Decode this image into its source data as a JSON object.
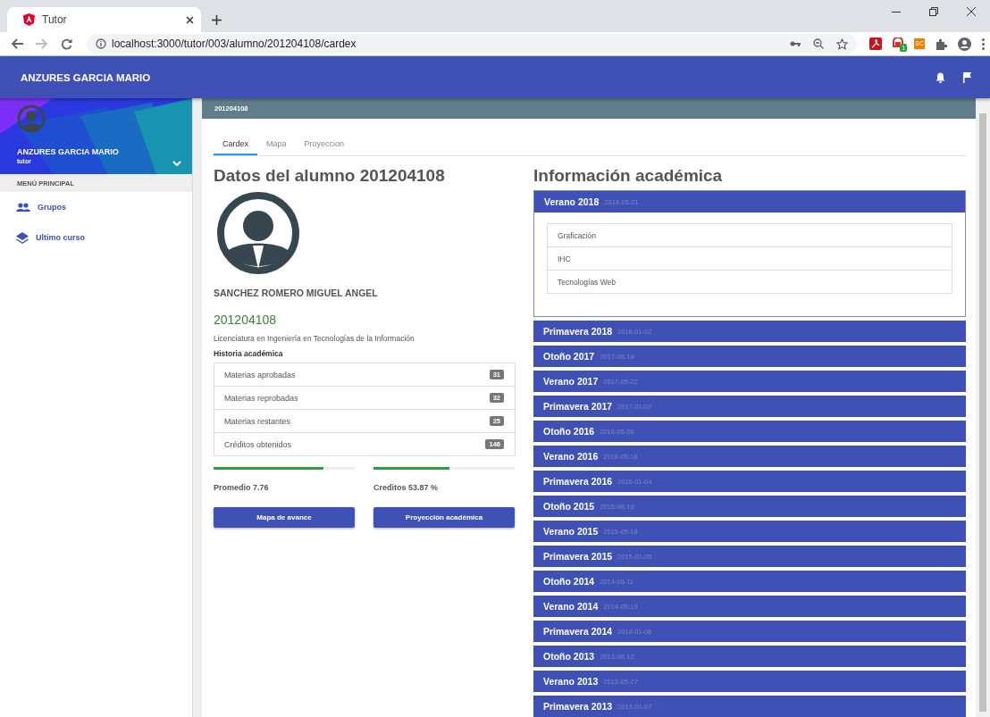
{
  "browser": {
    "tab_title": "Tutor",
    "url": "localhost:3000/tutor/003/alumno/201204108/cardex",
    "forward_disabled": true,
    "extensions": [
      {
        "kind": "pdf"
      },
      {
        "kind": "badge",
        "badge": "1"
      },
      {
        "kind": "text",
        "label": "SC"
      },
      {
        "kind": "puzzle"
      }
    ]
  },
  "toolbar": {
    "title": "ANZURES GARCIA MARIO"
  },
  "sidebar": {
    "user_name": "ANZURES GARCIA MARIO",
    "user_role": "tutor",
    "section": "MENÚ PRINCIPAL",
    "items": [
      {
        "label": "Grupos",
        "kind": "group",
        "selected": false
      },
      {
        "label": "Ultimo curso",
        "kind": "layers",
        "selected": false
      }
    ]
  },
  "breadcrumb": "201204108",
  "tabs": [
    {
      "label": "Cardex",
      "selected": true
    },
    {
      "label": "Mapa",
      "selected": false
    },
    {
      "label": "Proyeccion",
      "selected": false
    }
  ],
  "student": {
    "heading": "Datos del alumno 201204108",
    "name": "SANCHEZ ROMERO MIGUEL ANGEL",
    "id": "201204108",
    "program": "Licenciatura en Ingeniería en Tecnologías de la Información",
    "history_title": "Historia académica",
    "stats": [
      {
        "label": "Materias aprobadas",
        "count": "31"
      },
      {
        "label": "Materias reprobadas",
        "count": "32"
      },
      {
        "label": "Materias restantes",
        "count": "25"
      },
      {
        "label": "Créditos obtenidos",
        "count": "146"
      }
    ],
    "progress": [
      {
        "label": "Promedio 7.76",
        "level": 0.78
      },
      {
        "label": "Creditos 53.87 %",
        "level": 0.54
      }
    ],
    "buttons": [
      "Mapa de avance",
      "Proyección académica"
    ]
  },
  "academic": {
    "heading": "Información académica",
    "terms": [
      {
        "name": "Verano 2018",
        "date": "2018-05-21",
        "expanded": true,
        "subjects": [
          "Graficación",
          "IHC",
          "Tecnologías Web"
        ]
      },
      {
        "name": "Primavera 2018",
        "date": "2018-01-02",
        "expanded": false
      },
      {
        "name": "Otoño 2017",
        "date": "2017-08-14",
        "expanded": false
      },
      {
        "name": "Verano 2017",
        "date": "2017-05-22",
        "expanded": false
      },
      {
        "name": "Primavera 2017",
        "date": "2017-01-02",
        "expanded": false
      },
      {
        "name": "Otoño 2016",
        "date": "2016-08-08",
        "expanded": false
      },
      {
        "name": "Verano 2016",
        "date": "2016-05-16",
        "expanded": false
      },
      {
        "name": "Primavera 2016",
        "date": "2016-01-04",
        "expanded": false
      },
      {
        "name": "Otoño 2015",
        "date": "2015-08-10",
        "expanded": false
      },
      {
        "name": "Verano 2015",
        "date": "2015-05-18",
        "expanded": false
      },
      {
        "name": "Primavera 2015",
        "date": "2015-01-05",
        "expanded": false
      },
      {
        "name": "Otoño 2014",
        "date": "2014-08-11",
        "expanded": false
      },
      {
        "name": "Verano 2014",
        "date": "2014-05-19",
        "expanded": false
      },
      {
        "name": "Primavera 2014",
        "date": "2014-01-06",
        "expanded": false
      },
      {
        "name": "Otoño 2013",
        "date": "2013-08-12",
        "expanded": false
      },
      {
        "name": "Verano 2013",
        "date": "2013-05-27",
        "expanded": false
      },
      {
        "name": "Primavera 2013",
        "date": "2013-01-07",
        "expanded": false
      }
    ]
  }
}
